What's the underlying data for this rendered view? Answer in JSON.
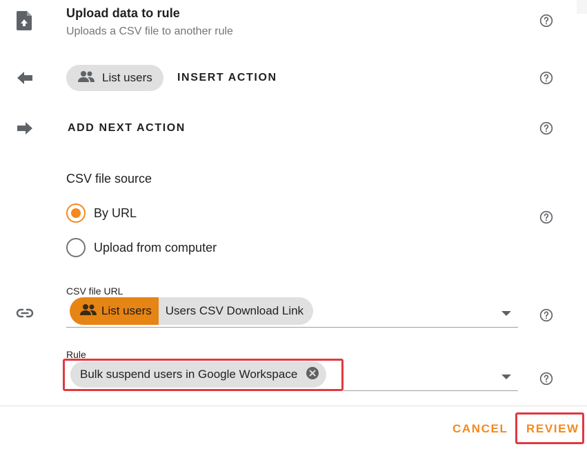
{
  "header": {
    "title": "Upload data to rule",
    "subtitle": "Uploads a CSV file to another rule"
  },
  "insert_row": {
    "chip_label": "List users",
    "action_label": "INSERT ACTION"
  },
  "next_row": {
    "action_label": "ADD NEXT ACTION"
  },
  "csv_source": {
    "label": "CSV file source",
    "options": [
      {
        "label": "By URL",
        "checked": true
      },
      {
        "label": "Upload from computer",
        "checked": false
      }
    ]
  },
  "csv_url": {
    "label": "CSV file URL",
    "source_label": "List users",
    "value_label": "Users CSV Download Link"
  },
  "rule": {
    "label": "Rule",
    "selected": "Bulk suspend users in Google Workspace"
  },
  "footer": {
    "cancel_label": "CANCEL",
    "review_label": "REVIEW"
  },
  "colors": {
    "accent": "#f5891f",
    "highlight": "#e0393f"
  }
}
